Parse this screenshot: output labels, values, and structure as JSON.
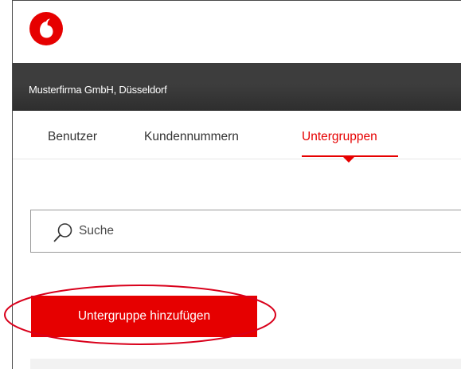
{
  "header": {
    "logo_icon": "vodafone-logo-icon",
    "company": "Musterfirma GmbH, Düsseldorf"
  },
  "tabs": [
    {
      "label": "Benutzer",
      "active": false
    },
    {
      "label": "Kundennummern",
      "active": false
    },
    {
      "label": "Untergruppen",
      "active": true
    }
  ],
  "search": {
    "placeholder": "Suche",
    "value": "",
    "icon": "search-icon"
  },
  "actions": {
    "add_subgroup": "Untergruppe hinzufügen"
  },
  "colors": {
    "brand_red": "#e60000",
    "bar_dark": "#3a3a3a",
    "annotation_red": "#d9001b"
  }
}
